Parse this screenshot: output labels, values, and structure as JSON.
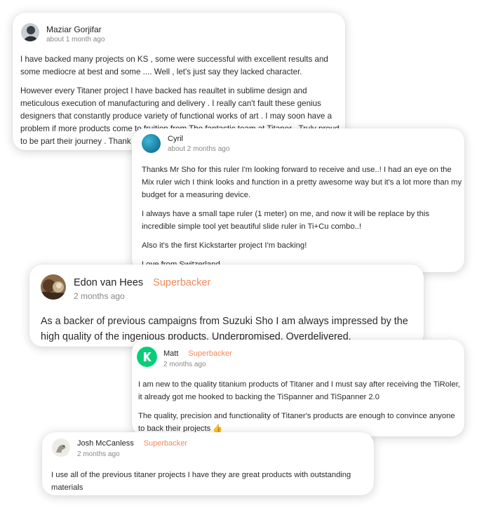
{
  "reviews": [
    {
      "author": "Maziar Gorjifar",
      "badge": "",
      "time": "about 1 month ago",
      "paragraphs": [
        "I have backed many projects on KS , some were successful with excellent results and some mediocre at best and some .... Well , let's just say they lacked character.",
        "However every Titaner project I have backed has reaultet in sublime design and meticulous execution of manufacturing and delivery . I really can't fault these genius designers that constantly produce variety of functional works of art . I may soon have a problem if more products come to fruition from The fantastic team at Titaner . Truly proud to be part their journey . Thank you"
      ]
    },
    {
      "author": "Cyril",
      "badge": "",
      "time": "about 2 months ago",
      "paragraphs": [
        "Thanks Mr Sho for this ruler I'm looking forward to receive and use..! I had an eye on the Mix ruler wich I think looks and function in a pretty awesome way but it's a lot more than my budget for a measuring device.",
        "I always have a small tape ruler (1 meter) on me, and now it will be replace by this incredible simple tool yet beautiful slide ruler in Ti+Cu combo..!",
        "Also it's the first Kickstarter project I'm backing!",
        "Love from Switzerland"
      ]
    },
    {
      "author": "Edon van Hees",
      "badge": "Superbacker",
      "time": "2 months ago",
      "paragraphs": [
        "As a backer of previous campaigns from Suzuki Sho I am always impressed by the high quality of the ingenious products. Underpromised. Overdelivered."
      ]
    },
    {
      "author": "Matt",
      "badge": "Superbacker",
      "time": "2 months ago",
      "paragraphs": [
        "I am new to the quality titanium products of Titaner and I must say after receiving the TiRoler, it already got me hooked to backing the TiSpanner and TiSpanner 2.0",
        "The quality, precision and functionality of Titaner's products are enough to convince anyone to back their projects 👍"
      ]
    },
    {
      "author": "Josh McCanless",
      "badge": "Superbacker",
      "time": "2 months ago",
      "paragraphs": [
        "I use all of the previous titaner projects I have they are great products with outstanding materials"
      ]
    }
  ],
  "colors": {
    "badge": "#f08a5d",
    "timestamp": "#888888",
    "kickstarter_green": "#05ce78"
  }
}
